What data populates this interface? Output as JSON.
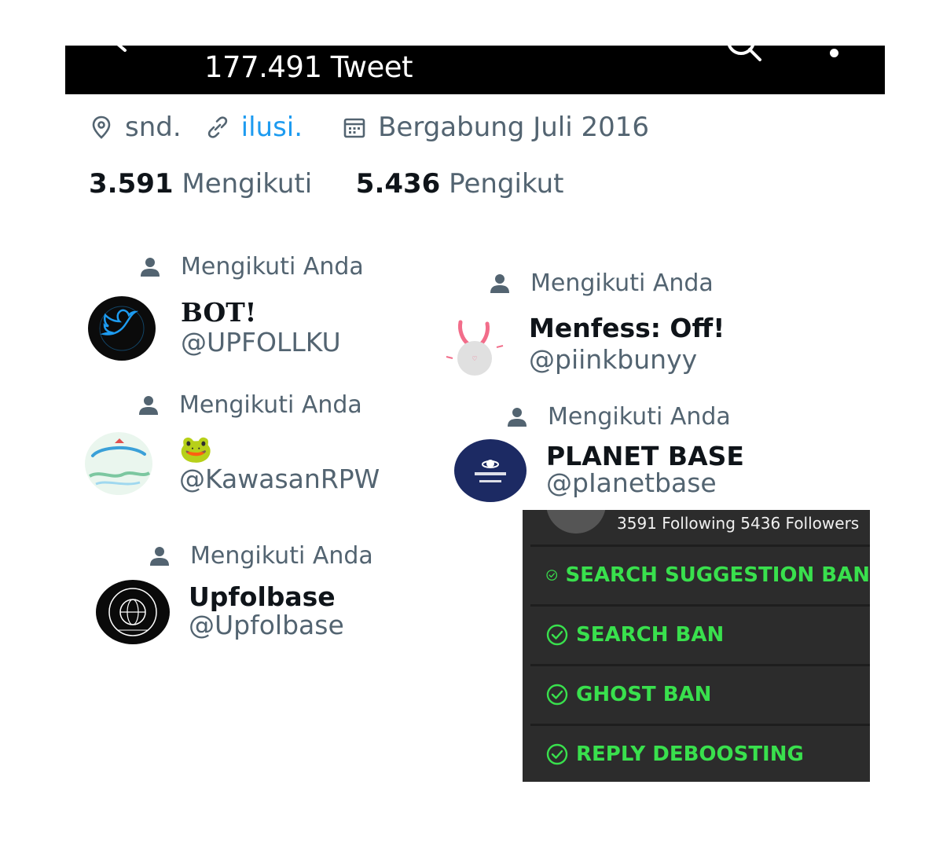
{
  "header": {
    "title": "177.491 Tweet"
  },
  "profile": {
    "location": "snd.",
    "link": "ilusi.",
    "joined": "Bergabung Juli 2016",
    "following_count": "3.591",
    "following_label": "Mengikuti",
    "followers_count": "5.436",
    "followers_label": "Pengikut"
  },
  "accounts": [
    {
      "follows_you": "Mengikuti Anda",
      "name": "BOT!",
      "handle": "@UPFOLLKU",
      "avatar_color": "#0b0b0b",
      "accent": "#1d9bf0"
    },
    {
      "follows_you": "Mengikuti Anda",
      "name": "Menfess: Off!",
      "handle": "@piinkbunyy",
      "avatar_color": "#e8e8e8",
      "accent": "#f26d8a"
    },
    {
      "follows_you": "Mengikuti Anda",
      "name": "🐸",
      "handle": "@KawasanRPW",
      "avatar_color": "#eaf6ee",
      "accent": "#3aa0d8"
    },
    {
      "follows_you": "Mengikuti Anda",
      "name": "PLANET BASE",
      "handle": "@pIanetbase",
      "avatar_color": "#1c2a63",
      "accent": "#ffffff"
    },
    {
      "follows_you": "Mengikuti Anda",
      "name": "Upfolbase",
      "handle": "@Upfolbase",
      "avatar_color": "#0a0a0a",
      "accent": "#ffffff"
    }
  ],
  "shadowban_panel": {
    "stats": "3591 Following 5436 Followers",
    "checks": [
      "SEARCH SUGGESTION BAN",
      "SEARCH BAN",
      "GHOST BAN",
      "REPLY DEBOOSTING"
    ],
    "check_color": "#39e04d"
  }
}
